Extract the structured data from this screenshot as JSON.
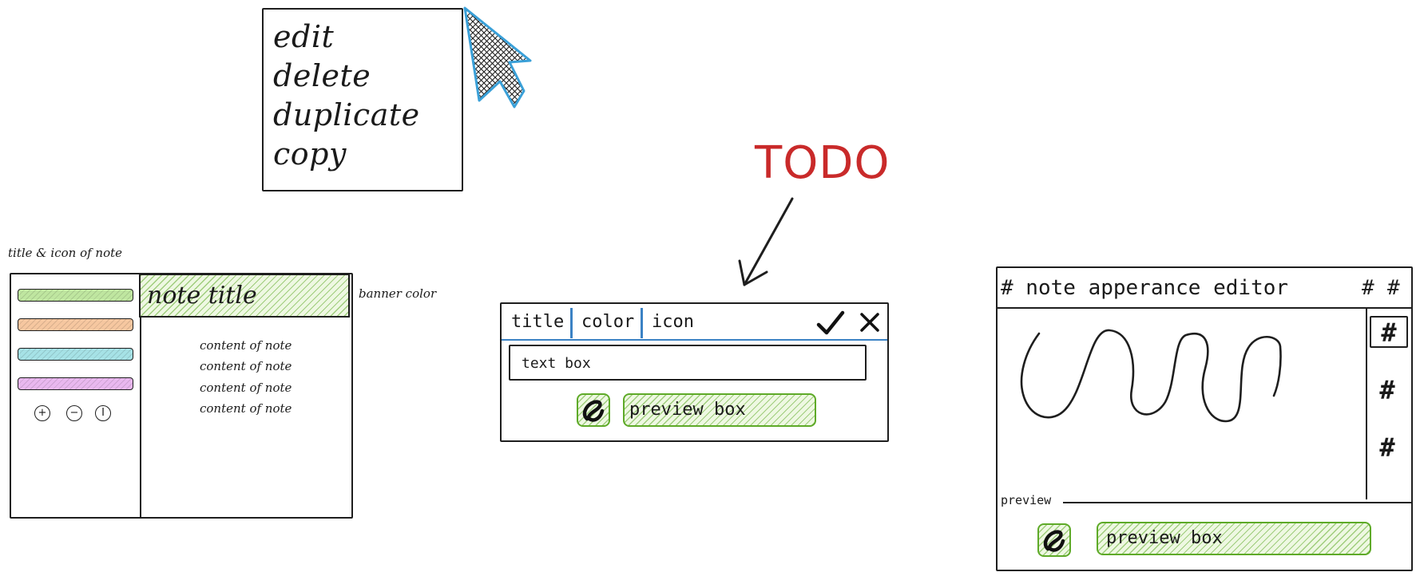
{
  "context_menu": {
    "items": [
      "edit",
      "delete",
      "duplicate",
      "copy"
    ],
    "cursor_icon": "pointer-cursor-icon"
  },
  "todo": {
    "label": "TODO",
    "color": "#c92a2a",
    "arrow_icon": "arrow-down-left-icon"
  },
  "note_mockup": {
    "annotation_title_icon": "title & icon of note",
    "annotation_banner": "banner color",
    "title": "note title",
    "content_lines": [
      "content of note",
      "content of note",
      "content of note",
      "content of note"
    ],
    "swatch_colors": [
      "#bfe6a0",
      "#f6c7a0",
      "#a6e2e6",
      "#e9b8ef"
    ],
    "banner_color": "#bfe6a0",
    "controls": [
      "add-icon",
      "remove-icon",
      "info-icon"
    ]
  },
  "dialog": {
    "tabs": [
      "title",
      "color",
      "icon"
    ],
    "confirm_icon": "check-icon",
    "close_icon": "close-icon",
    "text_box_value": "text box",
    "preview_label": "preview box",
    "preview_icon": "scribble-icon"
  },
  "editor": {
    "title": "# note apperance editor",
    "header_icons": [
      "#",
      "#"
    ],
    "side_icons": [
      "#",
      "#",
      "#"
    ],
    "preview_section_label": "preview",
    "preview_label": "preview box",
    "preview_icon": "scribble-icon"
  },
  "colors": {
    "accent_blue": "#3b82c4",
    "green": "#5eaa28",
    "stroke": "#1e1e1e"
  }
}
